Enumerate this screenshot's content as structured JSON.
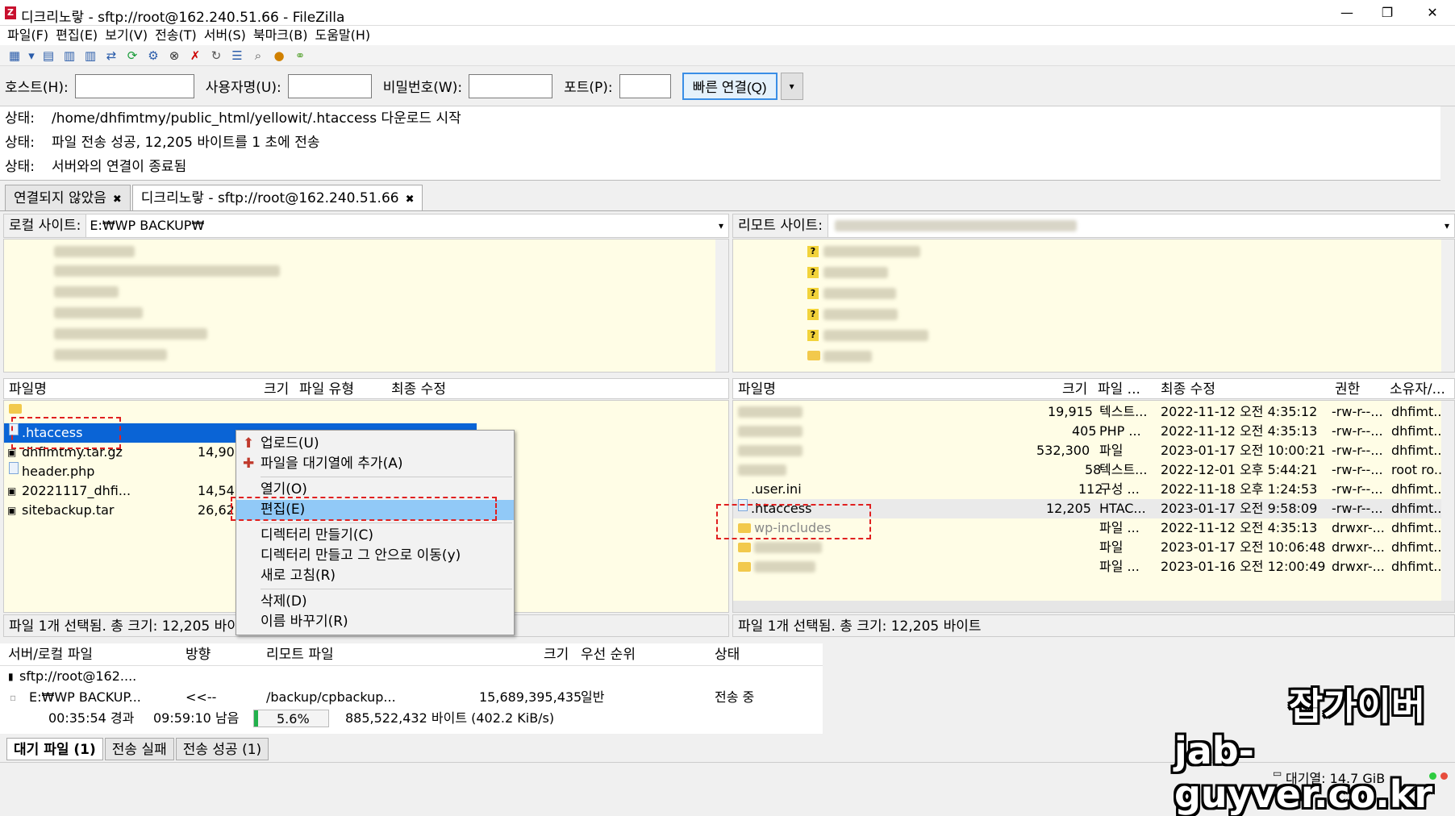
{
  "window": {
    "title": "디크리노랗 - sftp://root@162.240.51.66 - FileZilla",
    "minimize": "—",
    "restore": "❐",
    "close": "✕"
  },
  "menu": [
    "파일(F)",
    "편집(E)",
    "보기(V)",
    "전송(T)",
    "서버(S)",
    "북마크(B)",
    "도움말(H)"
  ],
  "quickconnect": {
    "host_label": "호스트(H):",
    "user_label": "사용자명(U):",
    "pass_label": "비밀번호(W):",
    "port_label": "포트(P):",
    "button": "빠른 연결(Q)",
    "dropdown": "▾"
  },
  "log": [
    {
      "label": "상태:",
      "text": "/home/dhfimtmy/public_html/yellowit/.htaccess 다운로드 시작"
    },
    {
      "label": "상태:",
      "text": "파일 전송 성공, 12,205 바이트를 1 초에 전송"
    },
    {
      "label": "상태:",
      "text": "서버와의 연결이 종료됨"
    }
  ],
  "tabs": [
    {
      "label": "연결되지 않았음",
      "close": "✖"
    },
    {
      "label": "디크리노랗 - sftp://root@162.240.51.66",
      "close": "✖"
    }
  ],
  "local": {
    "site_label": "로컬 사이트:",
    "path": "E:₩WP BACKUP₩",
    "columns": [
      "파일명",
      "크기",
      "파일 유형",
      "최종 수정"
    ],
    "files": [
      {
        "name": ".htaccess",
        "size": "",
        "icon": "file-icon"
      },
      {
        "name": "dhfimtmy.tar.gz",
        "size": "14,90",
        "icon": "archive-icon"
      },
      {
        "name": "header.php",
        "size": "",
        "icon": "php-file-icon"
      },
      {
        "name": "20221117_dhfi...",
        "size": "14,54",
        "icon": "archive-icon"
      },
      {
        "name": "sitebackup.tar",
        "size": "26,62",
        "icon": "archive-icon"
      }
    ],
    "status": "파일 1개 선택됨. 총 크기: 12,205 바이"
  },
  "remote": {
    "site_label": "리모트 사이트:",
    "columns": [
      "파일명",
      "크기",
      "파일 ...",
      "최종 수정",
      "권한",
      "소유자/..."
    ],
    "files": [
      {
        "name": "",
        "size": "19,915",
        "type": "텍스트...",
        "modified": "2022-11-12 오전 4:35:12",
        "perm": "-rw-r--...",
        "owner": "dhfimt..."
      },
      {
        "name": "",
        "size": "405",
        "type": "PHP ...",
        "modified": "2022-11-12 오전 4:35:13",
        "perm": "-rw-r--...",
        "owner": "dhfimt..."
      },
      {
        "name": "",
        "size": "532,300",
        "type": "파일",
        "modified": "2023-01-17 오전 10:00:21",
        "perm": "-rw-r--...",
        "owner": "dhfimt..."
      },
      {
        "name": "",
        "size": "58",
        "type": "텍스트...",
        "modified": "2022-12-01 오후 5:44:21",
        "perm": "-rw-r--...",
        "owner": "root ro..."
      },
      {
        "name": ".user.ini",
        "size": "112",
        "type": "구성 ...",
        "modified": "2022-11-18 오후 1:24:53",
        "perm": "-rw-r--...",
        "owner": "dhfimt..."
      },
      {
        "name": ".htaccess",
        "size": "12,205",
        "type": "HTAC...",
        "modified": "2023-01-17 오전 9:58:09",
        "perm": "-rw-r--...",
        "owner": "dhfimt..."
      },
      {
        "name": "wp-includes",
        "size": "",
        "type": "파일 ...",
        "modified": "2022-11-12 오전 4:35:13",
        "perm": "drwxr-...",
        "owner": "dhfimt..."
      },
      {
        "name": "",
        "size": "",
        "type": "파일",
        "modified": "2023-01-17 오전 10:06:48",
        "perm": "drwxr-...",
        "owner": "dhfimt..."
      },
      {
        "name": "",
        "size": "",
        "type": "파일 ...",
        "modified": "2023-01-16 오전 12:00:49",
        "perm": "drwxr-...",
        "owner": "dhfimt..."
      }
    ],
    "status": "파일 1개 선택됨. 총 크기: 12,205 바이트"
  },
  "context_menu": {
    "items": [
      "업로드(U)",
      "파일을 대기열에 추가(A)",
      "열기(O)",
      "편집(E)",
      "디렉터리 만들기(C)",
      "디렉터리 만들고 그 안으로 이동(y)",
      "새로 고침(R)",
      "삭제(D)",
      "이름 바꾸기(R)"
    ],
    "highlighted": "편집(E)"
  },
  "queue": {
    "columns": [
      "서버/로컬 파일",
      "방향",
      "리모트 파일",
      "크기",
      "우선 순위",
      "상태"
    ],
    "server": "sftp://root@162....",
    "row": {
      "local": "E:₩WP BACKUP...",
      "direction": "<<--",
      "remote": "/backup/cpbackup...",
      "size": "15,689,395,435",
      "priority": "일반",
      "status": "전송 중"
    },
    "progress": {
      "elapsed": "00:35:54 경과",
      "remaining": "09:59:10 남음",
      "percent_label": "5.6%",
      "percent": 5.6,
      "bytes": "885,522,432 바이트 (402.2 KiB/s)"
    }
  },
  "bottom_tabs": [
    "대기 파일 (1)",
    "전송 실패",
    "전송 성공 (1)"
  ],
  "statusbar": {
    "queue": "대기열: 14.7 GiB"
  },
  "watermark": {
    "line1": "잡가이버",
    "line2": "jab-guyver.co.kr"
  }
}
